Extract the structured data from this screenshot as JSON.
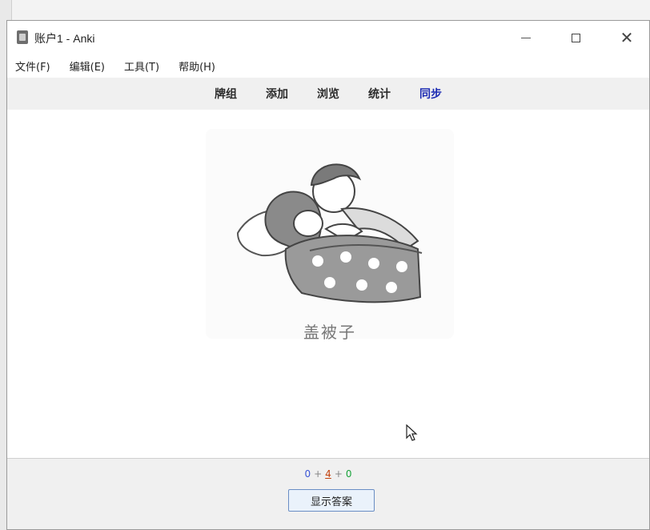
{
  "window": {
    "title": "账户1 - Anki",
    "close_glyph": "✕"
  },
  "menubar": {
    "items": [
      "文件(F)",
      "编辑(E)",
      "工具(T)",
      "帮助(H)"
    ]
  },
  "toolbar": {
    "items": [
      {
        "label": "牌组"
      },
      {
        "label": "添加"
      },
      {
        "label": "浏览"
      },
      {
        "label": "统计"
      },
      {
        "label": "同步",
        "active": true
      }
    ]
  },
  "card": {
    "caption": "盖被子",
    "image_subject": "illustration of a person tucking a blanket over someone in bed"
  },
  "review": {
    "new_count": "0",
    "learn_count": "4",
    "review_count": "0",
    "separator": "+",
    "show_answer_label": "显示答案"
  },
  "colors": {
    "new": "#3b56d6",
    "learn": "#c2410c",
    "review": "#19a33a",
    "sync_active": "#1c2bb3"
  }
}
